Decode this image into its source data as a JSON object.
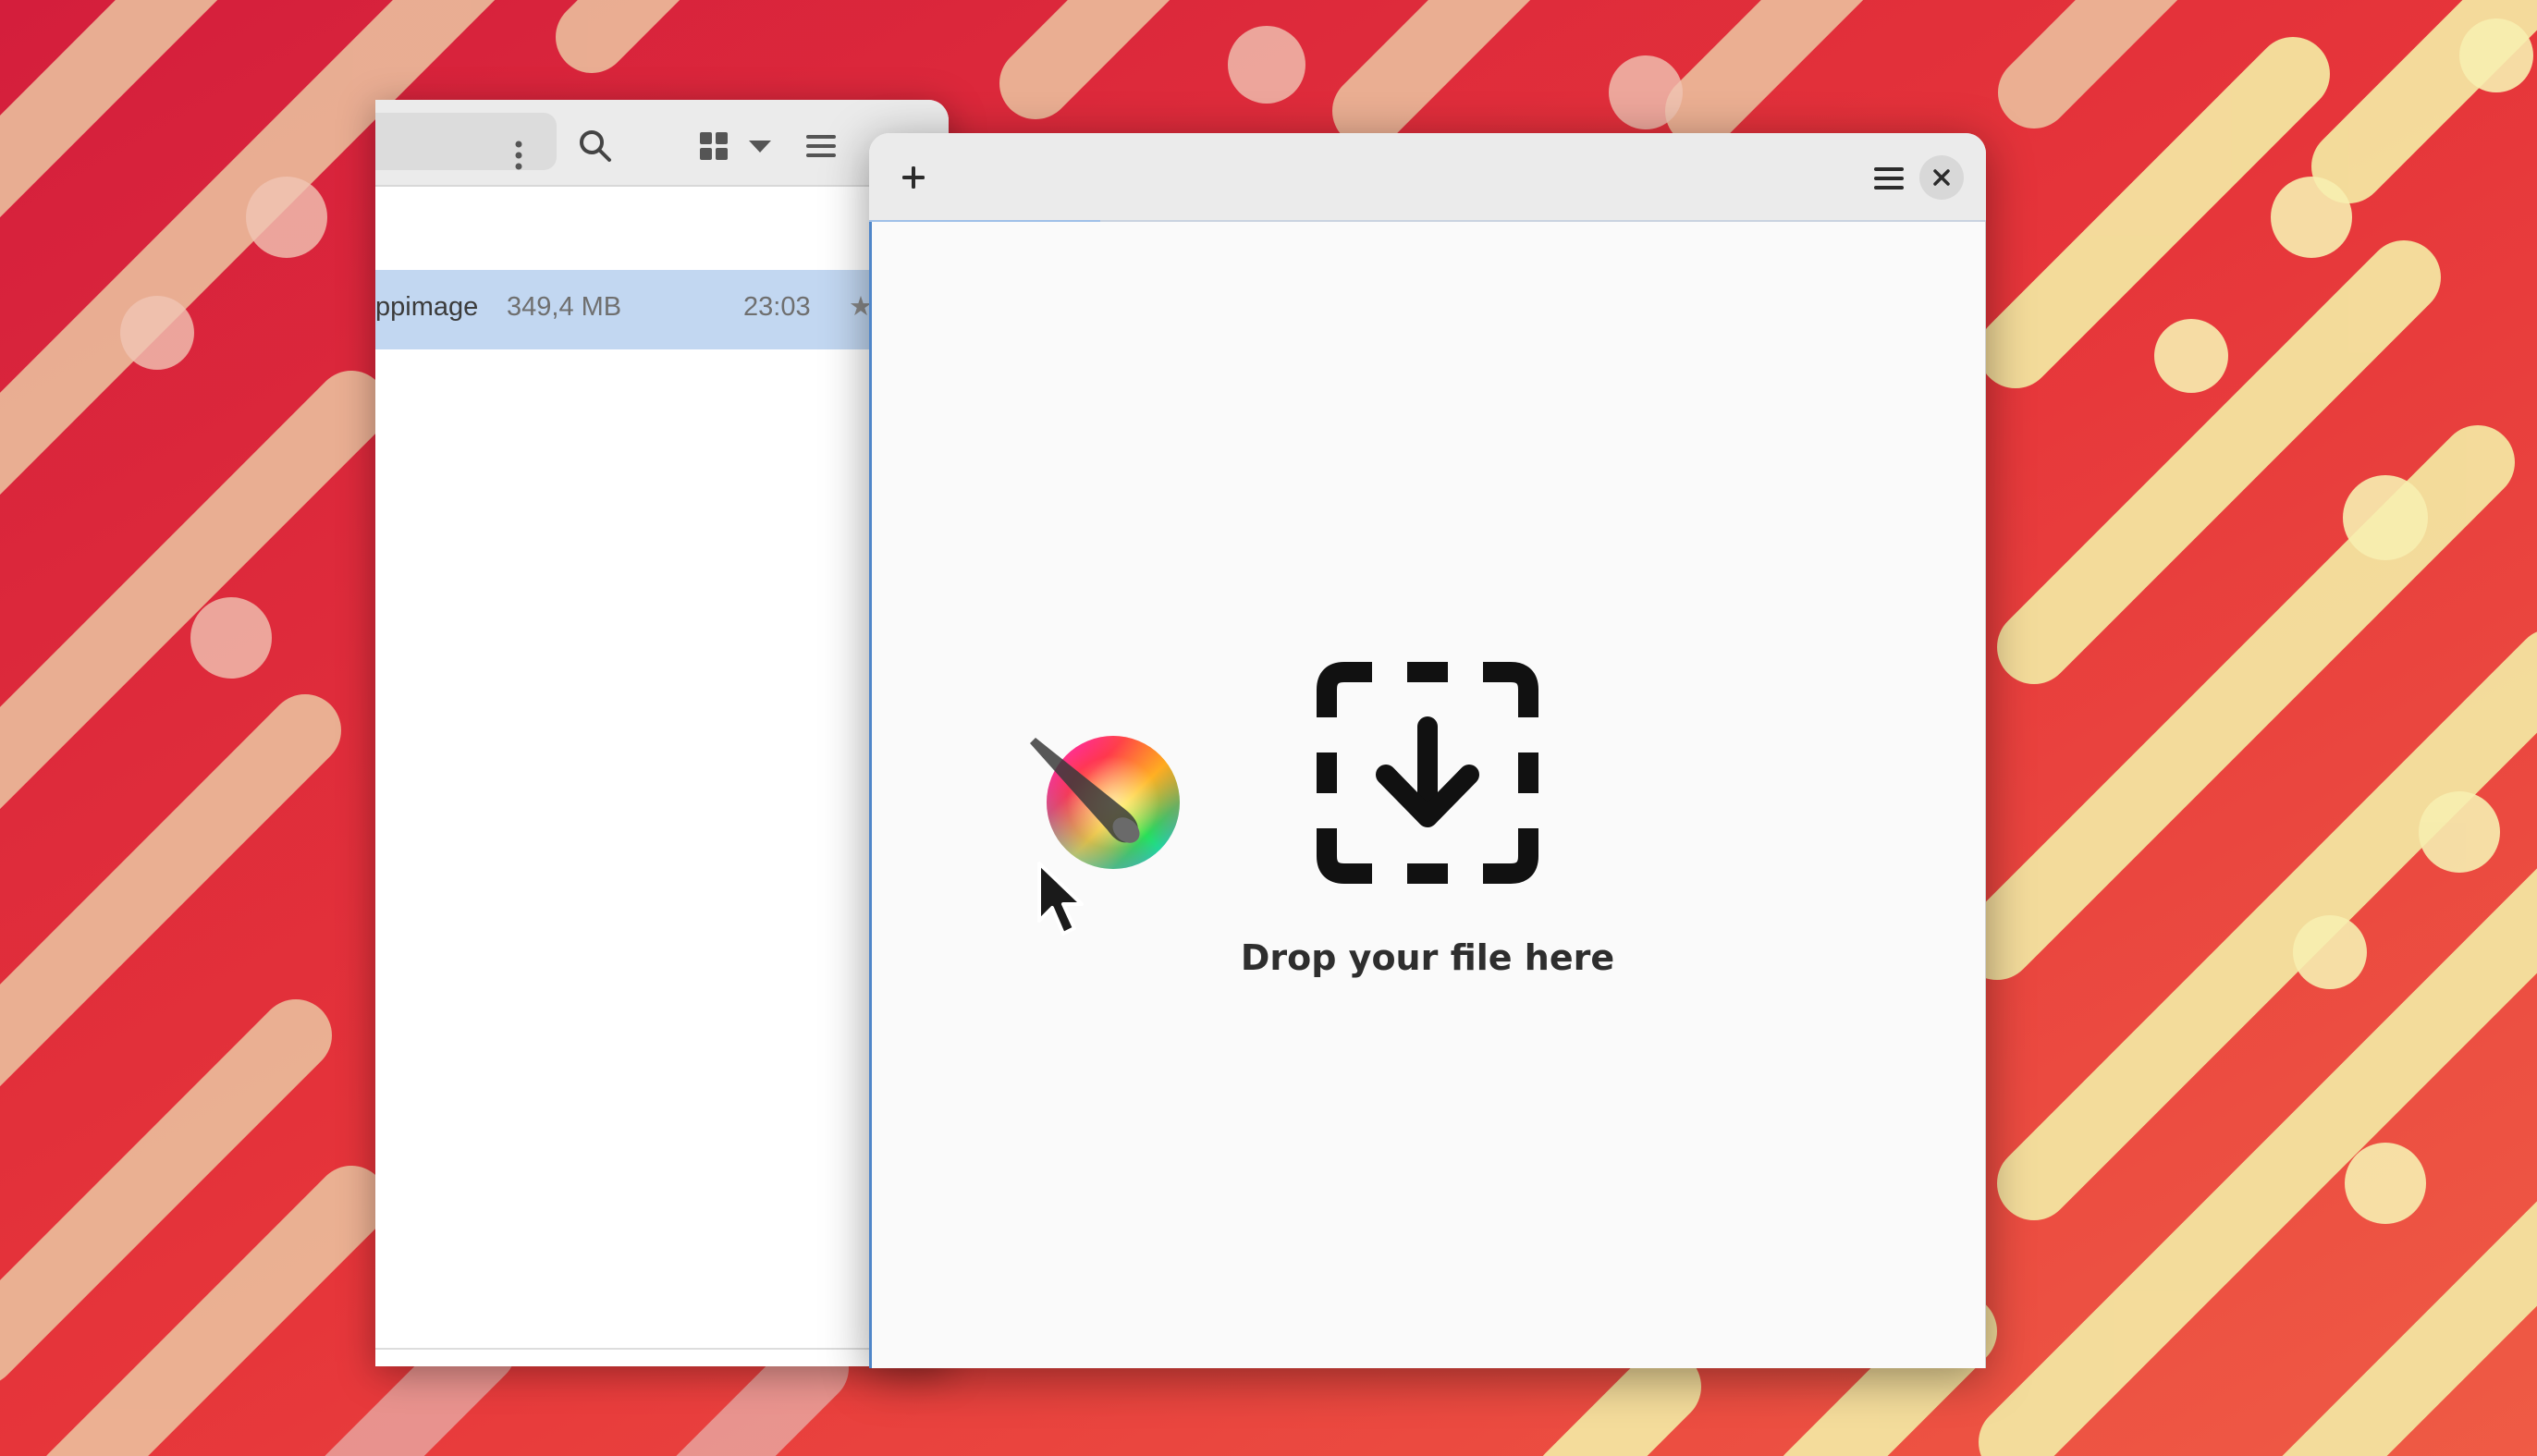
{
  "desktop": {
    "wallpaper": "red-and-yellow-tube-pattern"
  },
  "files_window": {
    "file_row": {
      "name": "ppimage",
      "size": "349,4 MB",
      "time": "23:03",
      "star_icon": "★"
    },
    "icons": [
      "kebab-menu-icon",
      "search-icon",
      "grid-view-icon",
      "dropdown-arrow-icon",
      "list-menu-icon"
    ]
  },
  "app_window": {
    "plus_label": "+",
    "drop_label": "Drop your file here",
    "icons": [
      "plus-icon",
      "hamburger-menu-icon",
      "close-icon",
      "drop-target-icon"
    ]
  },
  "colors": {
    "selection": "#c2d7f1",
    "accent_border": "#4f86c9",
    "header_bg": "#ebebeb",
    "content_bg": "#fafafa"
  }
}
